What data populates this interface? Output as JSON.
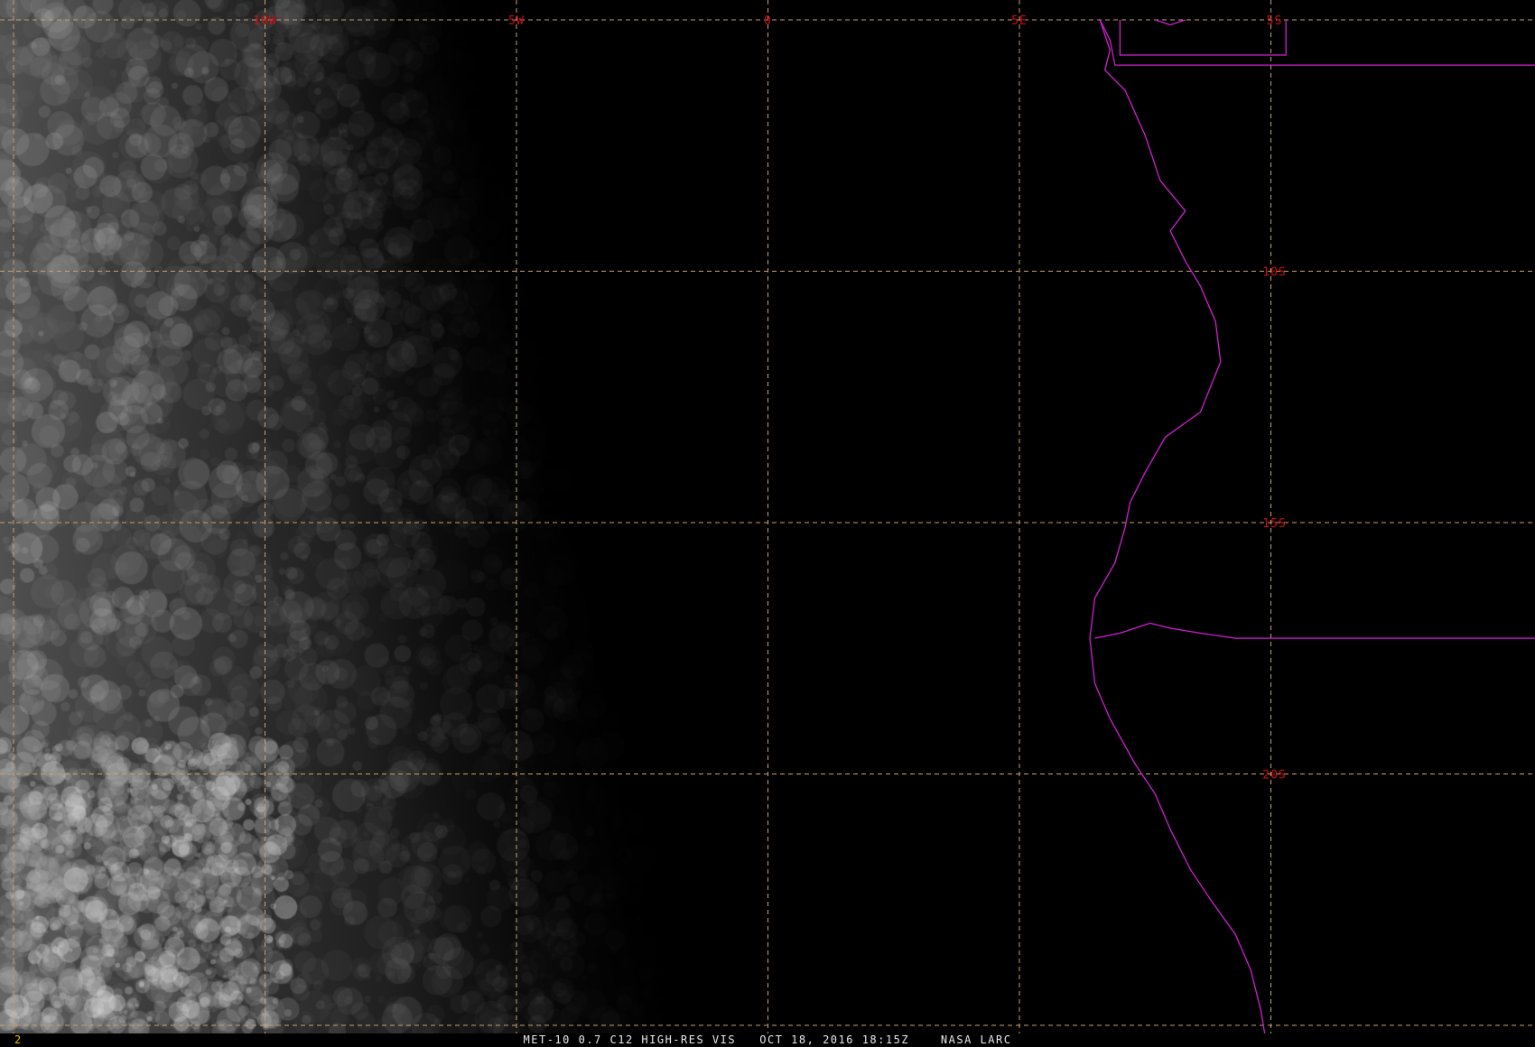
{
  "image": {
    "satellite": "MET-10",
    "band": "0.7",
    "channel": "C12",
    "product": "HIGH-RES VIS",
    "date": "OCT 18, 2016",
    "time": "18:15Z",
    "source": "NASA LARC",
    "caption": "MET-10 0.7 C12 HIGH-RES VIS   OCT 18, 2016 18:15Z    NASA LARC",
    "frame_number": "2"
  },
  "grid": {
    "longitudes": [
      {
        "label": "10W",
        "lon": -10
      },
      {
        "label": "5W",
        "lon": -5
      },
      {
        "label": "0",
        "lon": 0
      },
      {
        "label": "5E",
        "lon": 5
      }
    ],
    "latitudes": [
      {
        "label": "5S",
        "lat": -5
      },
      {
        "label": "10S",
        "lat": -10
      },
      {
        "label": "15S",
        "lat": -15
      },
      {
        "label": "20S",
        "lat": -20
      }
    ],
    "lon_range": [
      -15,
      15.5
    ],
    "lat_range": [
      -5,
      -25.3
    ],
    "line_style": "dashed"
  },
  "colors": {
    "background": "#000000",
    "grid_line": "#c8a070",
    "grid_label": "#cc1010",
    "coastline": "#d020d0",
    "caption_text": "#e8e8e8",
    "frame_number": "#e0c000",
    "cloud": "#b4b4b4"
  },
  "coastline": {
    "coast": [
      [
        6.6,
        -5.0
      ],
      [
        6.8,
        -5.6
      ],
      [
        6.7,
        -6.0
      ],
      [
        7.1,
        -6.4
      ],
      [
        7.5,
        -7.3
      ],
      [
        7.8,
        -8.2
      ],
      [
        8.3,
        -8.8
      ],
      [
        8.0,
        -9.2
      ],
      [
        8.3,
        -9.8
      ],
      [
        8.6,
        -10.3
      ],
      [
        8.9,
        -11.0
      ],
      [
        9.0,
        -11.8
      ],
      [
        8.6,
        -12.8
      ],
      [
        7.9,
        -13.3
      ],
      [
        7.5,
        -14.0
      ],
      [
        7.2,
        -14.6
      ],
      [
        7.1,
        -15.1
      ],
      [
        6.9,
        -15.8
      ],
      [
        6.5,
        -16.5
      ],
      [
        6.4,
        -17.3
      ],
      [
        6.5,
        -18.2
      ],
      [
        6.8,
        -18.9
      ],
      [
        7.3,
        -19.8
      ],
      [
        7.7,
        -20.4
      ],
      [
        8.0,
        -21.1
      ],
      [
        8.4,
        -21.9
      ],
      [
        8.8,
        -22.5
      ],
      [
        9.3,
        -23.2
      ],
      [
        9.6,
        -23.9
      ],
      [
        9.8,
        -24.7
      ],
      [
        9.9,
        -25.3
      ]
    ],
    "north_border_cabinda": [
      [
        6.6,
        -5.0
      ],
      [
        6.8,
        -5.4
      ],
      [
        6.9,
        -5.9
      ],
      [
        7.4,
        -5.9
      ],
      [
        8.0,
        -5.9
      ],
      [
        9.0,
        -5.9
      ],
      [
        10.3,
        -5.9
      ],
      [
        15.5,
        -5.9
      ]
    ],
    "drc_border": [
      [
        7.7,
        -5.0
      ],
      [
        8.0,
        -5.1
      ],
      [
        8.3,
        -5.0
      ]
    ],
    "namibia_border": [
      [
        6.5,
        -17.3
      ],
      [
        7.0,
        -17.2
      ],
      [
        7.6,
        -17.0
      ],
      [
        8.0,
        -17.1
      ],
      [
        8.6,
        -17.2
      ],
      [
        9.3,
        -17.3
      ],
      [
        10.0,
        -17.3
      ],
      [
        15.5,
        -17.3
      ]
    ],
    "cabinda_box": [
      [
        7.0,
        -5.0
      ],
      [
        7.0,
        -5.7
      ],
      [
        10.3,
        -5.7
      ],
      [
        10.3,
        -5.0
      ]
    ]
  }
}
